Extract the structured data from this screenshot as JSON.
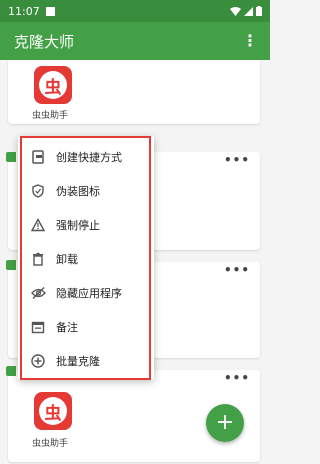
{
  "status_bar": {
    "time": "11:07",
    "icons": [
      "wifi-icon",
      "signal-icon",
      "battery-icon"
    ]
  },
  "app_bar": {
    "title": "克隆大师",
    "more_icon": "more-vert-icon"
  },
  "cards": [
    {
      "label": "虫虫助手",
      "menu_icon": "more-horiz-icon"
    },
    {
      "label": "",
      "menu_icon": "more-horiz-icon"
    },
    {
      "label": "",
      "menu_icon": "more-horiz-icon"
    },
    {
      "label": "虫虫助手",
      "menu_icon": "more-horiz-icon"
    }
  ],
  "app_icon_glyph": "虫",
  "menu": {
    "items": [
      {
        "label": "创建快捷方式",
        "icon": "shortcut-icon"
      },
      {
        "label": "伪装图标",
        "icon": "shield-icon"
      },
      {
        "label": "强制停止",
        "icon": "warning-icon"
      },
      {
        "label": "卸载",
        "icon": "trash-icon"
      },
      {
        "label": "隐藏应用程序",
        "icon": "eye-off-icon"
      },
      {
        "label": "备注",
        "icon": "calendar-icon"
      },
      {
        "label": "批量克隆",
        "icon": "add-circle-icon"
      }
    ]
  },
  "fab": {
    "label": "+"
  },
  "colors": {
    "primary": "#43a047",
    "primary_dark": "#388e3c",
    "highlight_border": "#e53935"
  }
}
